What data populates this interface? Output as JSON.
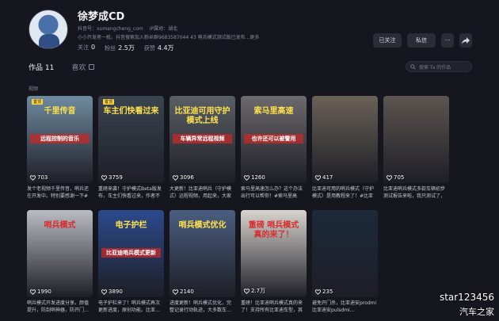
{
  "profile": {
    "name": "徐梦成CD",
    "douyin_id": "抖音号：xumengcheng_com",
    "ip_location": "IP属地：湖北",
    "bio": "小小开发者一枚。抖音搜索加入粉丝群9683587044 43 哨兵模式测试版已发布...更多",
    "following_label": "关注",
    "following_count": "0",
    "followers_label": "粉丝",
    "followers_count": "2.5万",
    "likes_label": "获赞",
    "likes_count": "4.4万"
  },
  "actions": {
    "followed_label": "已关注",
    "message_label": "私信",
    "more_label": "···"
  },
  "tabs": [
    {
      "label": "作品 11"
    },
    {
      "label": "喜欢"
    }
  ],
  "search": {
    "placeholder": "搜索 Ta 的作品"
  },
  "section_label": "视频",
  "videos": [
    {
      "likes": "703",
      "caption": "发个老视频千里传音，哨兵还在开发中。特别要感谢一下#比亚迪 #新能源汽车",
      "overlay": "千里传音",
      "sub": "远程控制的音乐",
      "badge": "置顶",
      "bg": "#6f8aa0"
    },
    {
      "likes": "3759",
      "caption": "重磅来袭！守护模式Beta版发布，车主们快看过来，作者不会回复私信，再也不…",
      "overlay": "车主们快看过来",
      "sub": "",
      "badge": "置顶",
      "bg": "#3a4450"
    },
    {
      "likes": "3096",
      "caption": "大更新！比亚迪哨兵（守护模式）远程视频，用起来，大家都可以体…",
      "overlay": "比亚迪可用守护模式上线",
      "sub": "车辆异常远程视频",
      "badge": "",
      "bg": "#5a5f66"
    },
    {
      "likes": "1260",
      "caption": "索马里高速怎么办？这个办法出行可以帮你！#索马里高速…",
      "overlay": "索马里高速",
      "sub": "也许还可以被警用",
      "badge": "",
      "bg": "#6d6a6e"
    },
    {
      "likes": "417",
      "caption": "比亚迪可用的哨兵模式（守护模式）是用教程来了！#比亚迪…",
      "overlay": "",
      "sub": "",
      "badge": "",
      "bg": "#6a6258"
    },
    {
      "likes": "705",
      "caption": "比亚迪哨兵模式多款车辆初步测试报告来啦，我只测试了，到底长什么样…",
      "overlay": "",
      "sub": "",
      "badge": "",
      "bg": "#5c5550"
    },
    {
      "likes": "1990",
      "caption": "哨兵模式开发进度分享。颜值提升，防刮哨神器，防开门…",
      "overlay": "哨兵模式",
      "sub": "",
      "badge": "",
      "bg": "#b9bdc3"
    },
    {
      "likes": "3890",
      "caption": "电子护栏来了！哨兵模式再次更新进度，原创功能。比亚…",
      "overlay": "电子护栏",
      "sub": "比亚迪哨兵模式更新",
      "badge": "",
      "bg": "#2b4a8c"
    },
    {
      "likes": "2140",
      "caption": "进度更新！哨兵模式优化，完整记录行动轨迹，大多数车…",
      "overlay": "哨兵模式优化",
      "sub": "",
      "badge": "",
      "bg": "#4a5e80"
    },
    {
      "likes": "2.7万",
      "caption": "重磅！比亚迪哨兵模式真的来了！支持所有比亚迪车型，其他汽…",
      "overlay": "重磅 哨兵模式 真的来了！",
      "sub": "",
      "badge": "",
      "bg": "#d7d4cf"
    },
    {
      "likes": "235",
      "caption": "避免开门杀，比亚迪安prodmi比亚迪安pulsdmi…",
      "overlay": "",
      "sub": "",
      "badge": "",
      "bg": "#1c2a3a"
    }
  ],
  "watermark": {
    "user": "star123456",
    "site": "汽车之家"
  },
  "colors": {
    "background": "#16161f",
    "text": "#e8e8ec",
    "muted": "#8b8b97",
    "button": "#2c2c38"
  }
}
